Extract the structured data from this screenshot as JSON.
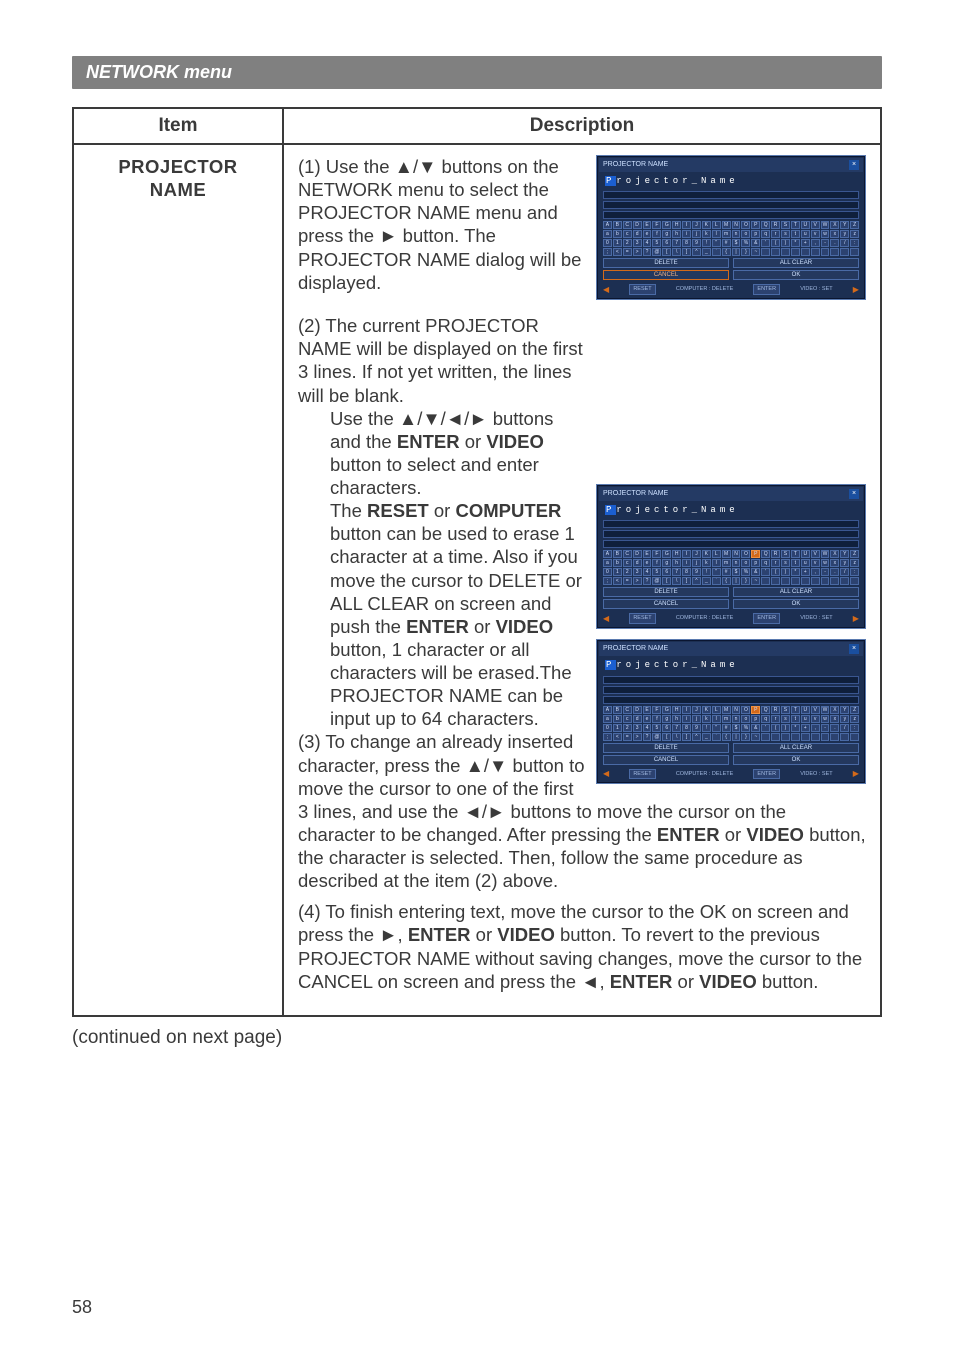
{
  "header": {
    "menu_title": "NETWORK menu"
  },
  "table": {
    "col_item": "Item",
    "col_desc": "Description",
    "item_name_line1": "PROJECTOR",
    "item_name_line2": "NAME"
  },
  "dialog": {
    "title": "PROJECTOR NAME",
    "name_plain": "Projector_Name",
    "row1": "ABCDEFGHIJKLMNOPQRSTUVWXYZ",
    "row2": "abcdefghijklmnopqrstuvwxyz",
    "row3": "0123456789!\"#$%&'()*+,-./:",
    "row4": ";<=>?@[\\]^_`{|}~            ",
    "btn_delete": "DELETE",
    "btn_allclear": "ALL CLEAR",
    "btn_cancel": "CANCEL",
    "btn_ok": "OK",
    "foot_reset": "RESET",
    "foot_comp_del": "COMPUTER : DELETE",
    "foot_enter": "ENTER",
    "foot_video_set": "VIDEO : SET"
  },
  "desc": {
    "p1_lead": "(1) Use the ",
    "p1_a": "▲/▼ buttons on the NETWORK menu to select the PROJECTOR NAME menu and press the ► button. The PROJECTOR NAME dialog will be displayed.",
    "p2_lead": "(2) The current PROJECTOR NAME will be displayed on the first 3 lines. If not yet written, the lines will be blank.",
    "p2_b": "Use the ▲/▼/◄/► buttons and the ",
    "enter": "ENTER",
    "or": " or ",
    "video": "VIDEO",
    "p2_c": " button to select and enter characters.",
    "p2_d": "The ",
    "reset": "RESET",
    "computer": "COMPUTER",
    "p2_e": " button can be used to erase 1 character at a time. Also if you move the cursor to DELETE or ALL CLEAR on screen and push the ",
    "p2_f": " button, 1 character or all characters will be erased.The PROJECTOR NAME can be input up to 64 characters.",
    "p3_lead": "(3) To change an already inserted character, press the ▲/▼ button to move the cursor to one of the first 3 lines, and use the ◄/► buttons to move the cursor on the character to be changed. After pressing the ",
    "p3_b": " button, the character is selected. Then, follow the same procedure as described at the item (2) above.",
    "p4_lead": "(4) To finish entering text, move the cursor to the OK on screen and press the ►, ",
    "p4_b": " button. To revert to the previous PROJECTOR NAME without saving changes, move the cursor to the CANCEL on screen and press the ◄, ",
    "p4_c": " button."
  },
  "continued": "(continued on next page)",
  "page_number": "58"
}
